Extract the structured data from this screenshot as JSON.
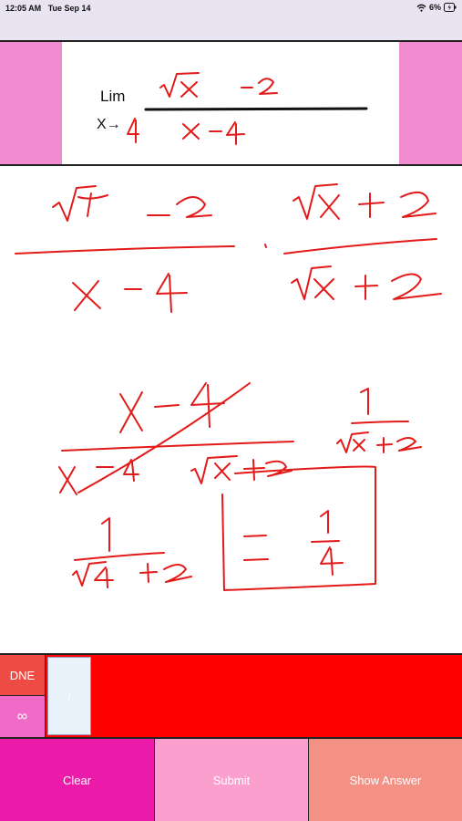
{
  "status_bar": {
    "time": "12:05 AM",
    "date": "Tue Sep 14",
    "battery": "6%"
  },
  "problem": {
    "lim_label": "Lim",
    "arrow_label": "X→"
  },
  "answer_row": {
    "dne_label": "DNE",
    "infinity_label": "∞",
    "input_value": "/"
  },
  "buttons": {
    "clear": "Clear",
    "submit": "Submit",
    "show_answer": "Show Answer"
  },
  "colors": {
    "ink": "#e31a1a",
    "accent_pink": "#f08ccf",
    "answer_red": "#ff0000",
    "clear_magenta": "#ec1aa8",
    "submit_pink": "#fb9fce",
    "show_answer_salmon": "#f39184"
  },
  "icons": {
    "wifi": "wifi-icon",
    "battery": "battery-icon"
  }
}
